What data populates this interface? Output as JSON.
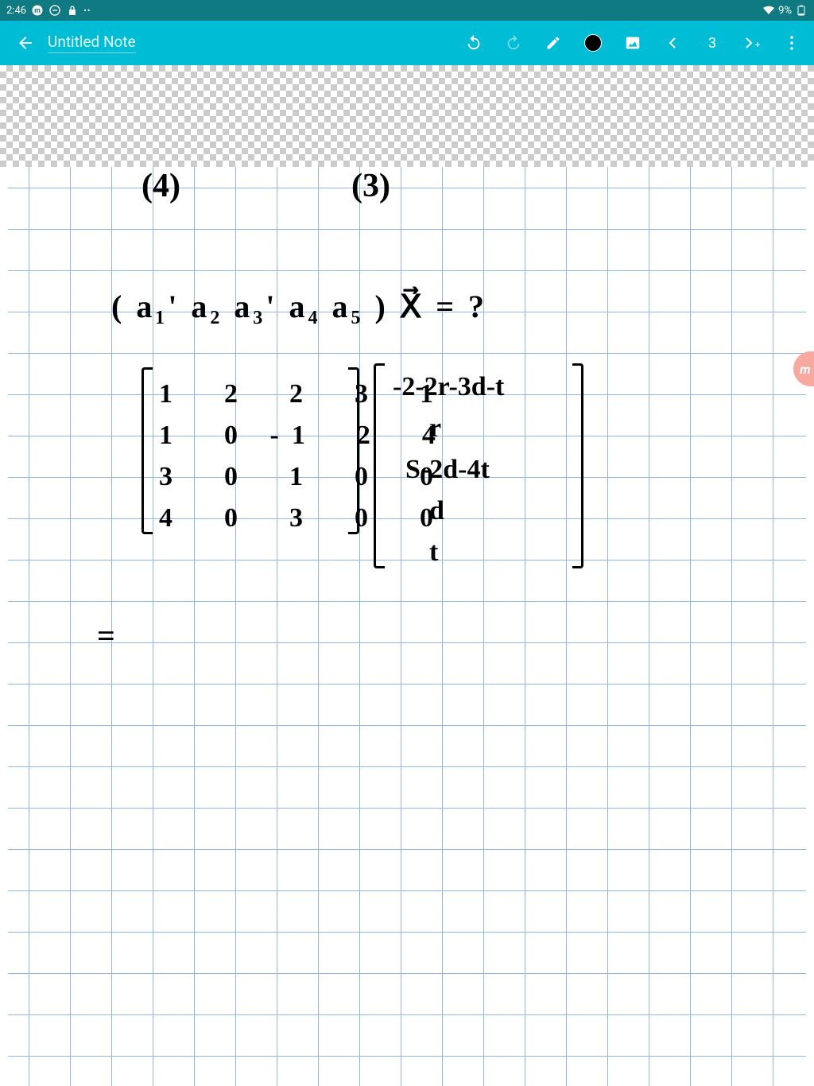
{
  "status": {
    "time": "2:46",
    "battery": "9%"
  },
  "app": {
    "title": "Untitled Note",
    "stroke_width": "3"
  },
  "handwriting": {
    "top_left": "(4)",
    "top_right": "(3)",
    "equation": "( a₁'  a₂  a₃'  a₄  a₅ ) X⃗ = ?",
    "matrix_rows": [
      "1  2  2  3  1",
      "1  0 -1  2  4",
      "3  0  1  0  0",
      "4  0  3  0  0"
    ],
    "vector_rows": [
      "-2-2r-3d-t",
      "r",
      "S-2d-4t",
      "d",
      "t"
    ],
    "equals": "="
  }
}
